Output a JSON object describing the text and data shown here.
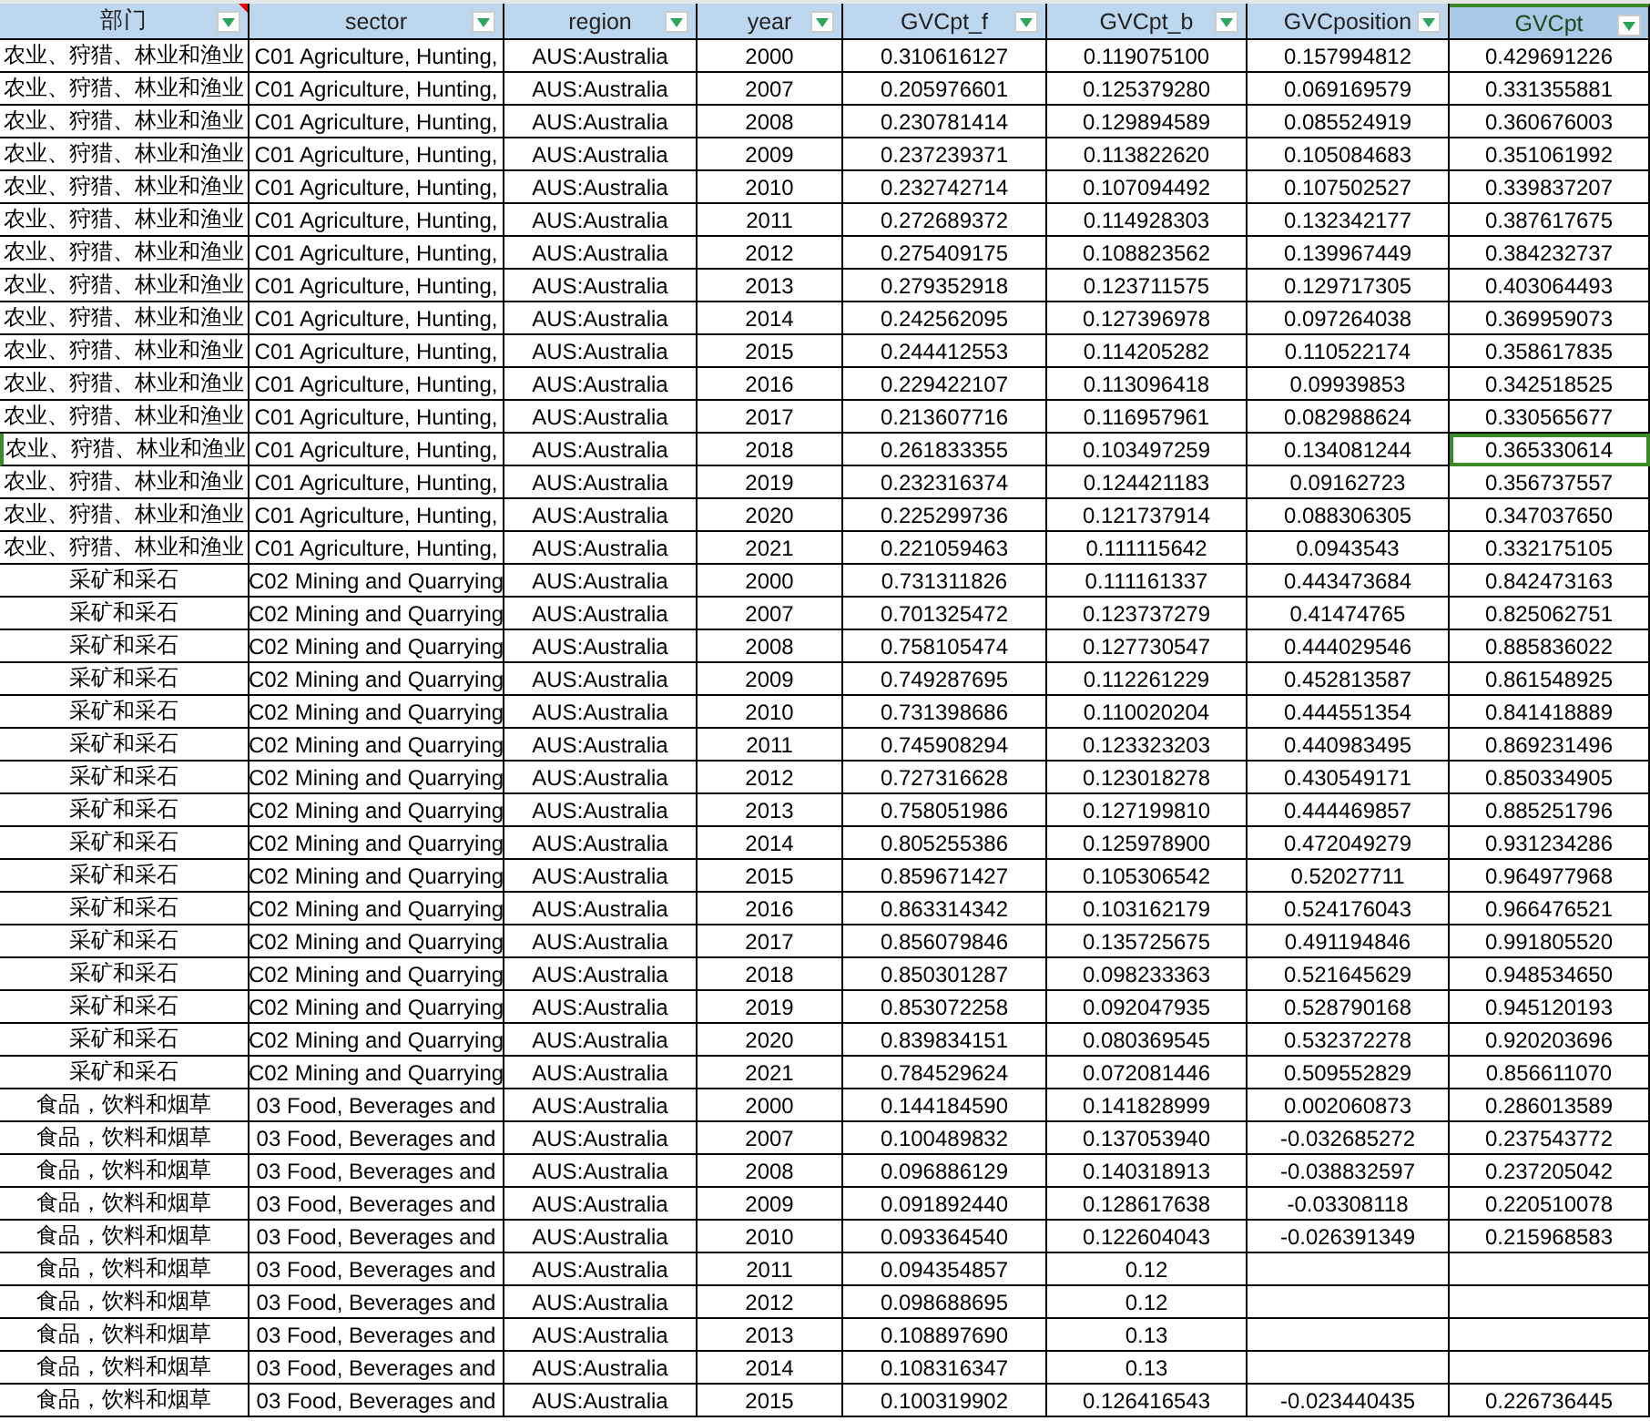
{
  "columns": [
    {
      "label": "部门",
      "filter": true,
      "comment": true,
      "selected": false
    },
    {
      "label": "sector",
      "filter": true,
      "comment": false,
      "selected": false
    },
    {
      "label": "region",
      "filter": true,
      "comment": false,
      "selected": false
    },
    {
      "label": "year",
      "filter": true,
      "comment": false,
      "selected": false
    },
    {
      "label": "GVCpt_f",
      "filter": true,
      "comment": false,
      "selected": false
    },
    {
      "label": "GVCpt_b",
      "filter": true,
      "comment": false,
      "selected": false
    },
    {
      "label": "GVCposition",
      "filter": true,
      "comment": false,
      "selected": false
    },
    {
      "label": "GVCpt",
      "filter": true,
      "comment": false,
      "selected": true
    }
  ],
  "rows": [
    {
      "selected": false,
      "cells": [
        "农业、狩猎、林业和渔业",
        "C01 Agriculture, Hunting,",
        "AUS:Australia",
        "2000",
        "0.310616127",
        "0.119075100",
        "0.157994812",
        "0.429691226"
      ]
    },
    {
      "selected": false,
      "cells": [
        "农业、狩猎、林业和渔业",
        "C01 Agriculture, Hunting,",
        "AUS:Australia",
        "2007",
        "0.205976601",
        "0.125379280",
        "0.069169579",
        "0.331355881"
      ]
    },
    {
      "selected": false,
      "cells": [
        "农业、狩猎、林业和渔业",
        "C01 Agriculture, Hunting,",
        "AUS:Australia",
        "2008",
        "0.230781414",
        "0.129894589",
        "0.085524919",
        "0.360676003"
      ]
    },
    {
      "selected": false,
      "cells": [
        "农业、狩猎、林业和渔业",
        "C01 Agriculture, Hunting,",
        "AUS:Australia",
        "2009",
        "0.237239371",
        "0.113822620",
        "0.105084683",
        "0.351061992"
      ]
    },
    {
      "selected": false,
      "cells": [
        "农业、狩猎、林业和渔业",
        "C01 Agriculture, Hunting,",
        "AUS:Australia",
        "2010",
        "0.232742714",
        "0.107094492",
        "0.107502527",
        "0.339837207"
      ]
    },
    {
      "selected": false,
      "cells": [
        "农业、狩猎、林业和渔业",
        "C01 Agriculture, Hunting,",
        "AUS:Australia",
        "2011",
        "0.272689372",
        "0.114928303",
        "0.132342177",
        "0.387617675"
      ]
    },
    {
      "selected": false,
      "cells": [
        "农业、狩猎、林业和渔业",
        "C01 Agriculture, Hunting,",
        "AUS:Australia",
        "2012",
        "0.275409175",
        "0.108823562",
        "0.139967449",
        "0.384232737"
      ]
    },
    {
      "selected": false,
      "cells": [
        "农业、狩猎、林业和渔业",
        "C01 Agriculture, Hunting,",
        "AUS:Australia",
        "2013",
        "0.279352918",
        "0.123711575",
        "0.129717305",
        "0.403064493"
      ]
    },
    {
      "selected": false,
      "cells": [
        "农业、狩猎、林业和渔业",
        "C01 Agriculture, Hunting,",
        "AUS:Australia",
        "2014",
        "0.242562095",
        "0.127396978",
        "0.097264038",
        "0.369959073"
      ]
    },
    {
      "selected": false,
      "cells": [
        "农业、狩猎、林业和渔业",
        "C01 Agriculture, Hunting,",
        "AUS:Australia",
        "2015",
        "0.244412553",
        "0.114205282",
        "0.110522174",
        "0.358617835"
      ]
    },
    {
      "selected": false,
      "cells": [
        "农业、狩猎、林业和渔业",
        "C01 Agriculture, Hunting,",
        "AUS:Australia",
        "2016",
        "0.229422107",
        "0.113096418",
        "0.09939853",
        "0.342518525"
      ]
    },
    {
      "selected": false,
      "cells": [
        "农业、狩猎、林业和渔业",
        "C01 Agriculture, Hunting,",
        "AUS:Australia",
        "2017",
        "0.213607716",
        "0.116957961",
        "0.082988624",
        "0.330565677"
      ]
    },
    {
      "selected": true,
      "cells": [
        "农业、狩猎、林业和渔业",
        "C01 Agriculture, Hunting,",
        "AUS:Australia",
        "2018",
        "0.261833355",
        "0.103497259",
        "0.134081244",
        "0.365330614"
      ]
    },
    {
      "selected": false,
      "cells": [
        "农业、狩猎、林业和渔业",
        "C01 Agriculture, Hunting,",
        "AUS:Australia",
        "2019",
        "0.232316374",
        "0.124421183",
        "0.09162723",
        "0.356737557"
      ]
    },
    {
      "selected": false,
      "cells": [
        "农业、狩猎、林业和渔业",
        "C01 Agriculture, Hunting,",
        "AUS:Australia",
        "2020",
        "0.225299736",
        "0.121737914",
        "0.088306305",
        "0.347037650"
      ]
    },
    {
      "selected": false,
      "cells": [
        "农业、狩猎、林业和渔业",
        "C01 Agriculture, Hunting,",
        "AUS:Australia",
        "2021",
        "0.221059463",
        "0.111115642",
        "0.0943543",
        "0.332175105"
      ]
    },
    {
      "selected": false,
      "cells": [
        "采矿和采石",
        "C02 Mining and Quarrying",
        "AUS:Australia",
        "2000",
        "0.731311826",
        "0.111161337",
        "0.443473684",
        "0.842473163"
      ]
    },
    {
      "selected": false,
      "cells": [
        "采矿和采石",
        "C02 Mining and Quarrying",
        "AUS:Australia",
        "2007",
        "0.701325472",
        "0.123737279",
        "0.41474765",
        "0.825062751"
      ]
    },
    {
      "selected": false,
      "cells": [
        "采矿和采石",
        "C02 Mining and Quarrying",
        "AUS:Australia",
        "2008",
        "0.758105474",
        "0.127730547",
        "0.444029546",
        "0.885836022"
      ]
    },
    {
      "selected": false,
      "cells": [
        "采矿和采石",
        "C02 Mining and Quarrying",
        "AUS:Australia",
        "2009",
        "0.749287695",
        "0.112261229",
        "0.452813587",
        "0.861548925"
      ]
    },
    {
      "selected": false,
      "cells": [
        "采矿和采石",
        "C02 Mining and Quarrying",
        "AUS:Australia",
        "2010",
        "0.731398686",
        "0.110020204",
        "0.444551354",
        "0.841418889"
      ]
    },
    {
      "selected": false,
      "cells": [
        "采矿和采石",
        "C02 Mining and Quarrying",
        "AUS:Australia",
        "2011",
        "0.745908294",
        "0.123323203",
        "0.440983495",
        "0.869231496"
      ]
    },
    {
      "selected": false,
      "cells": [
        "采矿和采石",
        "C02 Mining and Quarrying",
        "AUS:Australia",
        "2012",
        "0.727316628",
        "0.123018278",
        "0.430549171",
        "0.850334905"
      ]
    },
    {
      "selected": false,
      "cells": [
        "采矿和采石",
        "C02 Mining and Quarrying",
        "AUS:Australia",
        "2013",
        "0.758051986",
        "0.127199810",
        "0.444469857",
        "0.885251796"
      ]
    },
    {
      "selected": false,
      "cells": [
        "采矿和采石",
        "C02 Mining and Quarrying",
        "AUS:Australia",
        "2014",
        "0.805255386",
        "0.125978900",
        "0.472049279",
        "0.931234286"
      ]
    },
    {
      "selected": false,
      "cells": [
        "采矿和采石",
        "C02 Mining and Quarrying",
        "AUS:Australia",
        "2015",
        "0.859671427",
        "0.105306542",
        "0.52027711",
        "0.964977968"
      ]
    },
    {
      "selected": false,
      "cells": [
        "采矿和采石",
        "C02 Mining and Quarrying",
        "AUS:Australia",
        "2016",
        "0.863314342",
        "0.103162179",
        "0.524176043",
        "0.966476521"
      ]
    },
    {
      "selected": false,
      "cells": [
        "采矿和采石",
        "C02 Mining and Quarrying",
        "AUS:Australia",
        "2017",
        "0.856079846",
        "0.135725675",
        "0.491194846",
        "0.991805520"
      ]
    },
    {
      "selected": false,
      "cells": [
        "采矿和采石",
        "C02 Mining and Quarrying",
        "AUS:Australia",
        "2018",
        "0.850301287",
        "0.098233363",
        "0.521645629",
        "0.948534650"
      ]
    },
    {
      "selected": false,
      "cells": [
        "采矿和采石",
        "C02 Mining and Quarrying",
        "AUS:Australia",
        "2019",
        "0.853072258",
        "0.092047935",
        "0.528790168",
        "0.945120193"
      ]
    },
    {
      "selected": false,
      "cells": [
        "采矿和采石",
        "C02 Mining and Quarrying",
        "AUS:Australia",
        "2020",
        "0.839834151",
        "0.080369545",
        "0.532372278",
        "0.920203696"
      ]
    },
    {
      "selected": false,
      "cells": [
        "采矿和采石",
        "C02 Mining and Quarrying",
        "AUS:Australia",
        "2021",
        "0.784529624",
        "0.072081446",
        "0.509552829",
        "0.856611070"
      ]
    },
    {
      "selected": false,
      "cells": [
        "食品，饮料和烟草",
        "03 Food, Beverages and",
        "AUS:Australia",
        "2000",
        "0.144184590",
        "0.141828999",
        "0.002060873",
        "0.286013589"
      ]
    },
    {
      "selected": false,
      "cells": [
        "食品，饮料和烟草",
        "03 Food, Beverages and",
        "AUS:Australia",
        "2007",
        "0.100489832",
        "0.137053940",
        "-0.032685272",
        "0.237543772"
      ]
    },
    {
      "selected": false,
      "cells": [
        "食品，饮料和烟草",
        "03 Food, Beverages and",
        "AUS:Australia",
        "2008",
        "0.096886129",
        "0.140318913",
        "-0.038832597",
        "0.237205042"
      ]
    },
    {
      "selected": false,
      "cells": [
        "食品，饮料和烟草",
        "03 Food, Beverages and",
        "AUS:Australia",
        "2009",
        "0.091892440",
        "0.128617638",
        "-0.03308118",
        "0.220510078"
      ]
    },
    {
      "selected": false,
      "cells": [
        "食品，饮料和烟草",
        "03 Food, Beverages and",
        "AUS:Australia",
        "2010",
        "0.093364540",
        "0.122604043",
        "-0.026391349",
        "0.215968583"
      ]
    },
    {
      "selected": false,
      "cells": [
        "食品，饮料和烟草",
        "03 Food, Beverages and",
        "AUS:Australia",
        "2011",
        "0.094354857",
        "0.12",
        null,
        null
      ]
    },
    {
      "selected": false,
      "cells": [
        "食品，饮料和烟草",
        "03 Food, Beverages and",
        "AUS:Australia",
        "2012",
        "0.098688695",
        "0.12",
        null,
        null
      ]
    },
    {
      "selected": false,
      "cells": [
        "食品，饮料和烟草",
        "03 Food, Beverages and",
        "AUS:Australia",
        "2013",
        "0.108897690",
        "0.13",
        null,
        null
      ]
    },
    {
      "selected": false,
      "cells": [
        "食品，饮料和烟草",
        "03 Food, Beverages and",
        "AUS:Australia",
        "2014",
        "0.108316347",
        "0.13",
        null,
        null
      ]
    },
    {
      "selected": false,
      "cells": [
        "食品，饮料和烟草",
        "03 Food, Beverages and",
        "AUS:Australia",
        "2015",
        "0.100319902",
        "0.126416543",
        "-0.023440435",
        "0.226736445"
      ]
    }
  ]
}
